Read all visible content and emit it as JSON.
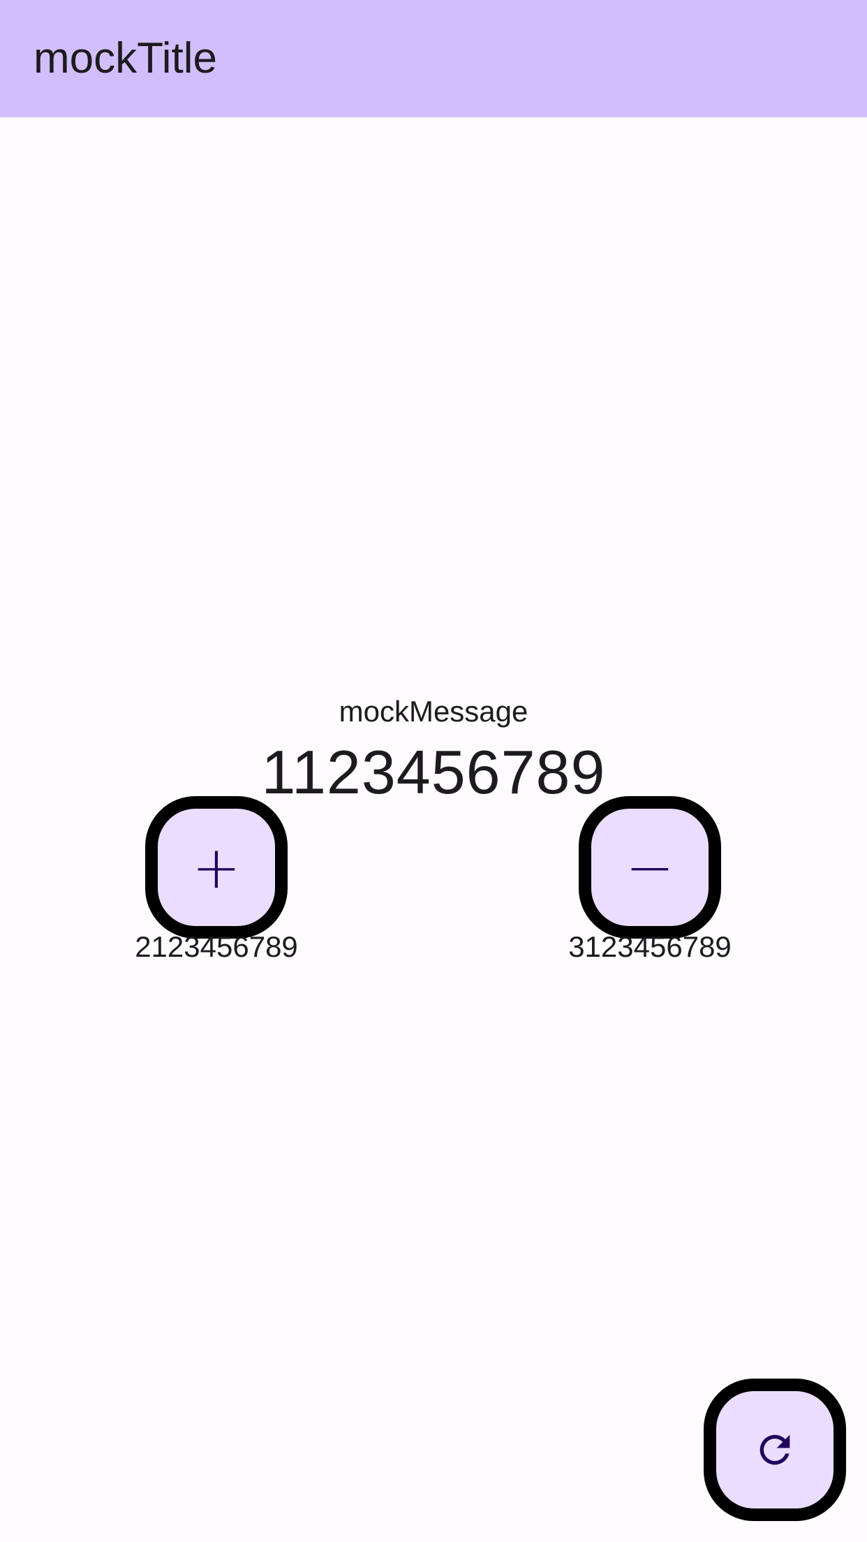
{
  "app_bar": {
    "title": "mockTitle"
  },
  "content": {
    "message": "mockMessage",
    "value": "1123456789"
  },
  "increment": {
    "symbol": "+",
    "count": "2123456789"
  },
  "decrement": {
    "symbol": "−",
    "count": "3123456789"
  },
  "refresh": {
    "icon": "refresh-icon"
  },
  "colors": {
    "app_bar": "#D2BEFD",
    "background": "#FFFBFE",
    "button_fill": "#EADDFF",
    "button_border": "#000000",
    "icon": "#21005D",
    "text": "#1C1B1F"
  }
}
